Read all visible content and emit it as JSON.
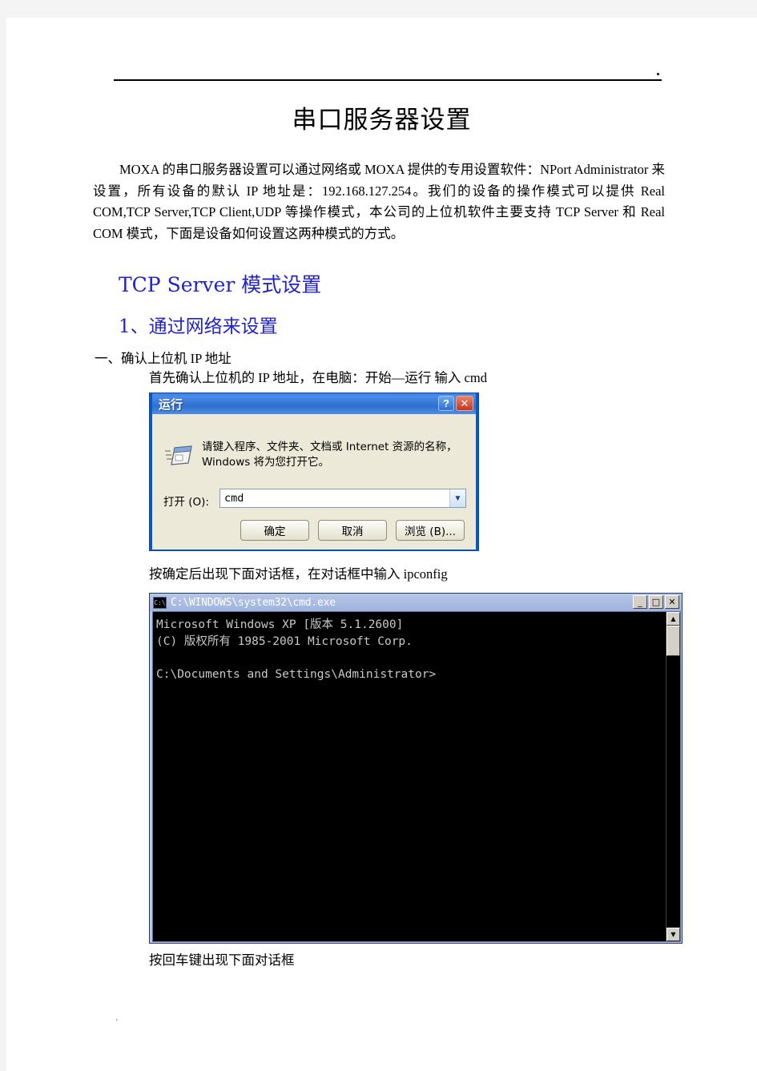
{
  "document": {
    "title": "串口服务器设置",
    "intro": "MOXA 的串口服务器设置可以通过网络或 MOXA 提供的专用设置软件：NPort Administrator 来设置，所有设备的默认 IP 地址是：192.168.127.254。我们的设备的操作模式可以提供 Real COM,TCP Server,TCP Client,UDP 等操作模式，本公司的上位机软件主要支持 TCP Server 和 Real COM 模式，下面是设备如何设置这两种模式的方式。",
    "heading1": "TCP Server  模式设置",
    "heading2": "1、通过网络来设置",
    "step1": "一、确认上位机 IP 地址",
    "step1_detail": "首先确认上位机的 IP 地址，在电脑：开始—运行 输入 cmd",
    "caption_after_run": "按确定后出现下面对话框，在对话框中输入 ipconfig",
    "caption_after_cmd": "按回车键出现下面对话框",
    "footer_mark": "'"
  },
  "run_dialog": {
    "title": "运行",
    "help_button": "?",
    "close_button": "✕",
    "description": "请键入程序、文件夹、文档或 Internet 资源的名称，Windows 将为您打开它。",
    "open_label": "打开 (O):",
    "open_value": "cmd",
    "open_placeholder": "",
    "dropdown_icon": "chevron-down-icon",
    "buttons": [
      {
        "label": "确定",
        "name": "ok-button"
      },
      {
        "label": "取消",
        "name": "cancel-button"
      },
      {
        "label": "浏览 (B)...",
        "name": "browse-button"
      }
    ],
    "titlebar_color": "#3f7fdd",
    "body_color": "#ece9d8"
  },
  "cmd_window": {
    "title": "C:\\WINDOWS\\system32\\cmd.exe",
    "icon_label": "C:\\",
    "minimize": "_",
    "maximize": "□",
    "close": "✕",
    "screen_text": "Microsoft Windows XP [版本 5.1.2600]\n(C) 版权所有 1985-2001 Microsoft Corp.\n\nC:\\Documents and Settings\\Administrator>",
    "scroll_up": "▲",
    "scroll_down": "▼",
    "background_color": "#000000",
    "text_color": "#c8c8c8"
  }
}
